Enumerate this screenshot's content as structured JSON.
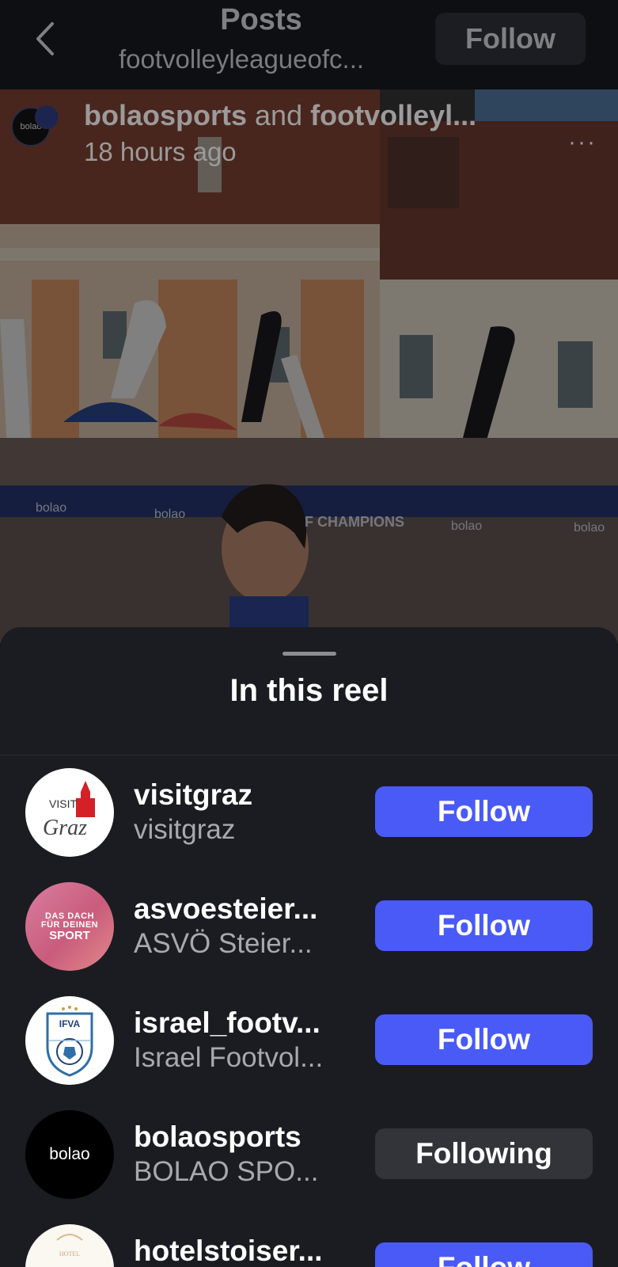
{
  "header": {
    "title": "Posts",
    "subtitle": "footvolleyleagueofc...",
    "follow_label": "Follow"
  },
  "post": {
    "author_primary": "bolaosports",
    "author_joiner": "and",
    "author_secondary": "footvolleyl...",
    "time_ago": "18 hours ago",
    "avatar_text": "bolao",
    "more_label": "···",
    "scene_texts": {
      "board_left": "bolao",
      "board_mid": "bolao",
      "board_champions": "F CHAMPIONS",
      "board_right1": "bolao",
      "board_right2": "bolao"
    }
  },
  "sheet": {
    "title": "In this reel",
    "accounts": [
      {
        "username": "visitgraz",
        "fullname": "visitgraz",
        "button": "Follow",
        "state": "follow",
        "avatar_line1": "VISIT",
        "avatar_line2": "Graz"
      },
      {
        "username": "asvoesteier...",
        "fullname": "ASVÖ Steier...",
        "button": "Follow",
        "state": "follow",
        "avatar_line1": "DAS DACH",
        "avatar_line2": "FÜR DEINEN",
        "avatar_line3": "SPORT"
      },
      {
        "username": "israel_footv...",
        "fullname": "Israel Footvol...",
        "button": "Follow",
        "state": "follow",
        "avatar_line1": "IFVA"
      },
      {
        "username": "bolaosports",
        "fullname": "BOLAO SPO...",
        "button": "Following",
        "state": "following",
        "avatar_line1": "bolao"
      },
      {
        "username": "hotelstoiser...",
        "fullname": "",
        "button": "Follow",
        "state": "follow",
        "avatar_line1": "HOTEL"
      }
    ]
  },
  "colors": {
    "sheet_bg": "#1b1c21",
    "follow_blue": "#4a5af7",
    "following_gray": "#33343a",
    "header_bg": "#0e0f13"
  }
}
